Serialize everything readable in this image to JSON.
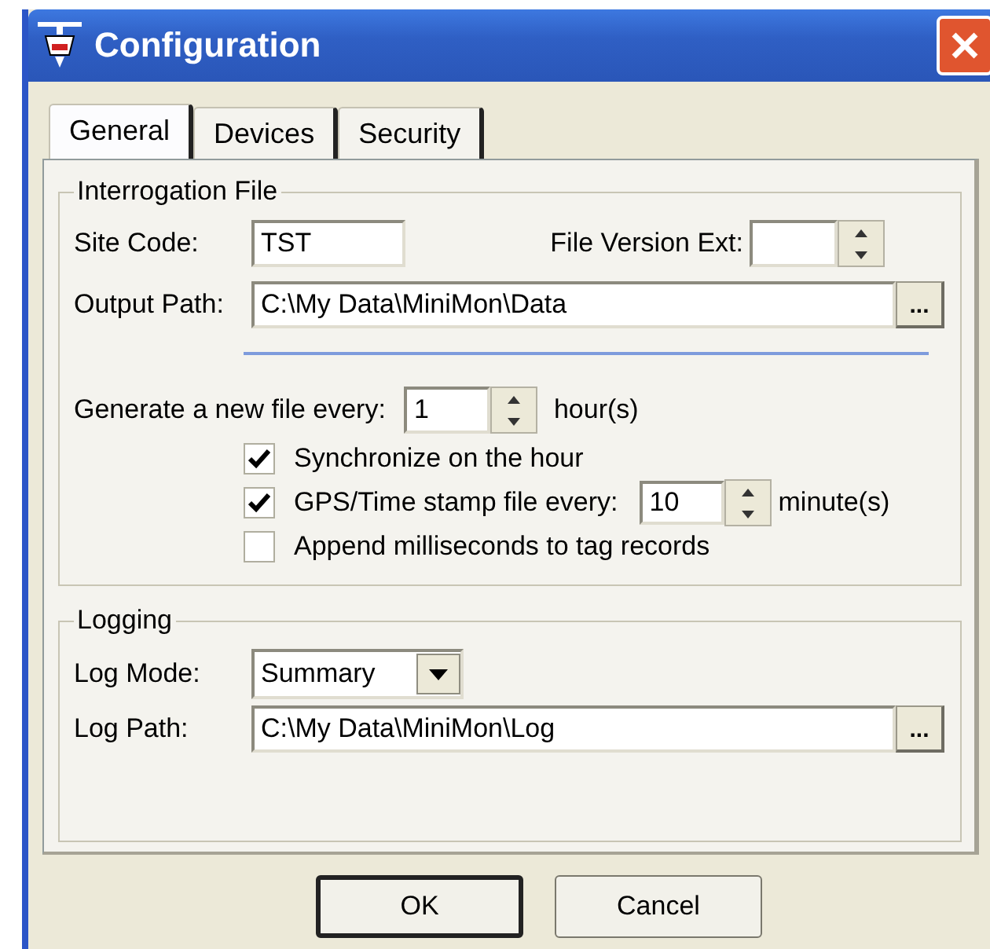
{
  "window": {
    "title": "Configuration"
  },
  "tabs": [
    {
      "label": "General",
      "selected": true
    },
    {
      "label": "Devices",
      "selected": false
    },
    {
      "label": "Security",
      "selected": false
    }
  ],
  "interrogation_file": {
    "title": "Interrogation File",
    "site_code": {
      "label": "Site Code:",
      "value": "TST"
    },
    "file_version_ext": {
      "label": "File Version Ext:"
    },
    "output_path": {
      "label": "Output Path:",
      "value": "C:\\My Data\\MiniMon\\Data",
      "browse": "..."
    },
    "generate": {
      "label": "Generate a new file every:",
      "value": "1",
      "unit": "hour(s)"
    },
    "options": [
      {
        "kind": "checkbox",
        "label": "Synchronize on the hour",
        "checked": true
      },
      {
        "kind": "interval",
        "label": "GPS/Time stamp file every:",
        "checked": true,
        "value": "10",
        "unit": "minute(s)"
      },
      {
        "kind": "checkbox",
        "label": "Append milliseconds to tag records",
        "checked": false
      }
    ]
  },
  "logging": {
    "title": "Logging",
    "log_mode": {
      "label": "Log Mode:",
      "value": "Summary"
    },
    "log_path": {
      "label": "Log Path:",
      "value": "C:\\My Data\\MiniMon\\Log",
      "browse": "..."
    }
  },
  "buttons": [
    {
      "label": "OK",
      "default": true
    },
    {
      "label": "Cancel",
      "default": false
    }
  ]
}
